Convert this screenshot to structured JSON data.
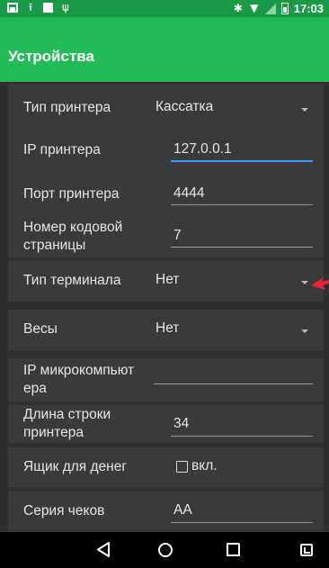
{
  "status_bar": {
    "time": "17:03",
    "left_icons": [
      "photo-icon",
      "upload-icon",
      "square-icon",
      "usb-icon"
    ],
    "right_icons": [
      "bluetooth-icon",
      "wifi-icon",
      "signal-icon",
      "battery-icon"
    ]
  },
  "app_bar": {
    "title": "Устройства"
  },
  "settings": {
    "printer_type": {
      "label": "Тип принтера",
      "value": "Кассатка"
    },
    "printer_ip": {
      "label": "IP принтера",
      "value": "127.0.0.1"
    },
    "printer_port": {
      "label": "Порт принтера",
      "value": "4444"
    },
    "codepage": {
      "label_line1": "Номер кодовой",
      "label_line2": "страницы",
      "value": "7"
    },
    "terminal_type": {
      "label": "Тип терминала",
      "value": "Нет"
    },
    "scales": {
      "label": "Весы",
      "value": "Нет"
    },
    "microcomputer_ip": {
      "label_line1": "IP микрокомпьют",
      "label_line2": "ера",
      "value": ""
    },
    "printer_line_length": {
      "label_line1": "Длина строки",
      "label_line2": "принтера",
      "value": "34"
    },
    "cash_drawer": {
      "label": "Ящик для денег",
      "checkbox_label": "вкл.",
      "checked": false
    },
    "receipt_series": {
      "label": "Серия чеков",
      "value": "AA"
    }
  },
  "nav_bar": {
    "icons": [
      "back-icon",
      "home-icon",
      "recent-apps-icon",
      "rotate-screen-icon"
    ]
  },
  "colors": {
    "status_bar": "#1a9a47",
    "app_bar": "#22bb57",
    "focus_underline": "#33a1ff",
    "annotation_arrow": "#e8233a"
  }
}
